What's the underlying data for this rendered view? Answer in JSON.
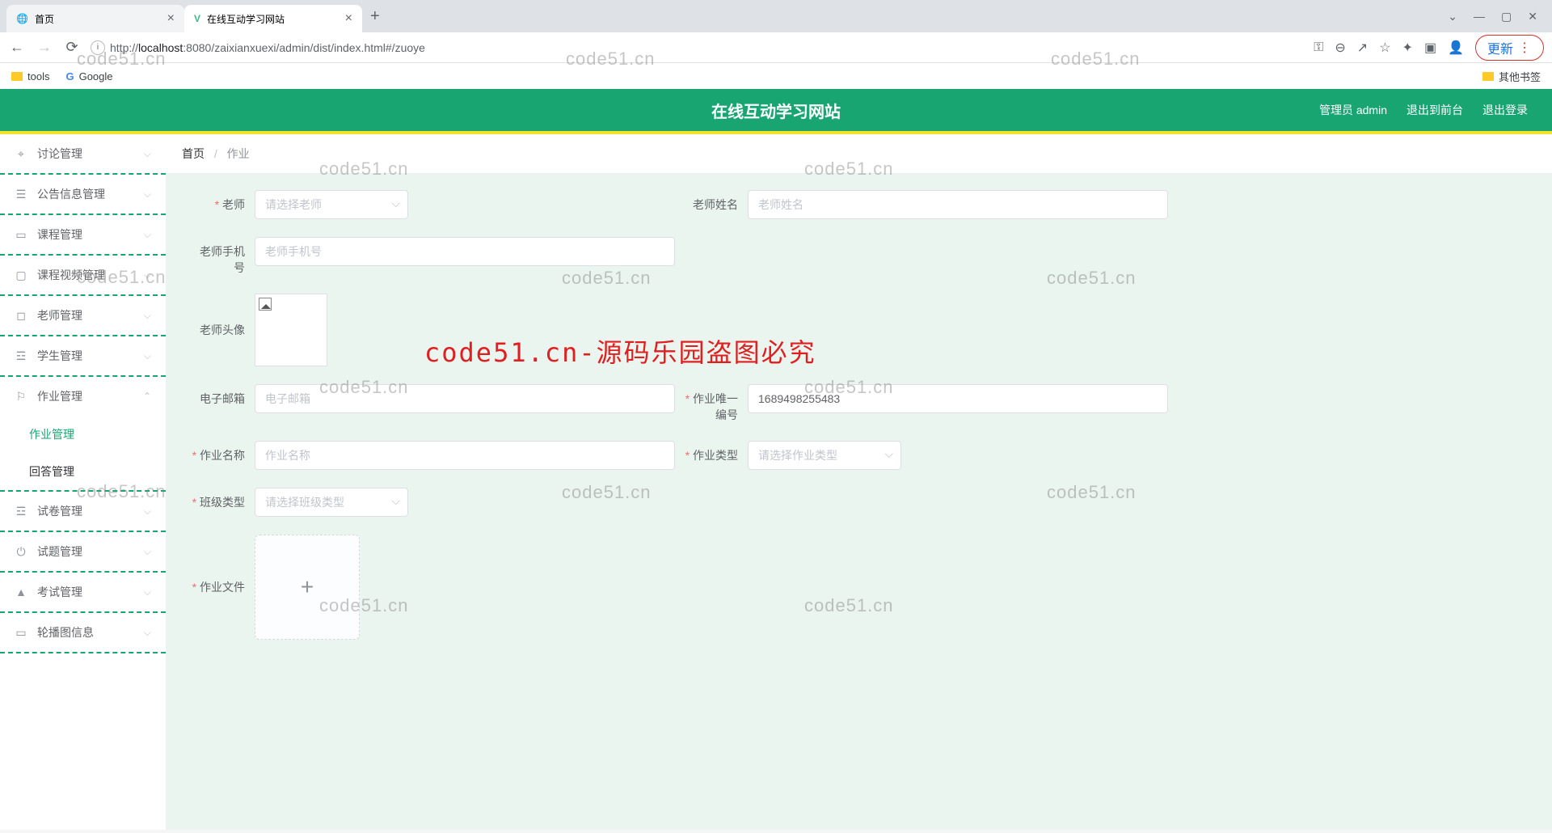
{
  "browser": {
    "tabs": [
      {
        "title": "首页",
        "active": false
      },
      {
        "title": "在线互动学习网站",
        "active": true
      }
    ],
    "url_host": "localhost",
    "url_port": ":8080",
    "url_path": "/zaixianxuexi/admin/dist/index.html#/zuoye",
    "update_label": "更新",
    "bookmarks": {
      "tools": "tools",
      "google": "Google",
      "other": "其他书签"
    }
  },
  "header": {
    "title": "在线互动学习网站",
    "admin": "管理员 admin",
    "front": "退出到前台",
    "logout": "退出登录"
  },
  "sidebar": {
    "items": [
      {
        "label": "讨论管理",
        "expandable": true
      },
      {
        "label": "公告信息管理",
        "expandable": true
      },
      {
        "label": "课程管理",
        "expandable": true
      },
      {
        "label": "课程视频管理",
        "expandable": true
      },
      {
        "label": "老师管理",
        "expandable": true
      },
      {
        "label": "学生管理",
        "expandable": true
      },
      {
        "label": "作业管理",
        "expandable": true,
        "open": true,
        "children": [
          "作业管理",
          "回答管理"
        ]
      },
      {
        "label": "试卷管理",
        "expandable": true
      },
      {
        "label": "试题管理",
        "expandable": true
      },
      {
        "label": "考试管理",
        "expandable": true
      },
      {
        "label": "轮播图信息",
        "expandable": true
      }
    ]
  },
  "breadcrumb": {
    "home": "首页",
    "current": "作业"
  },
  "form": {
    "teacher_label": "老师",
    "teacher_placeholder": "请选择老师",
    "teacher_name_label": "老师姓名",
    "teacher_name_placeholder": "老师姓名",
    "teacher_phone_label": "老师手机号",
    "teacher_phone_placeholder": "老师手机号",
    "teacher_avatar_label": "老师头像",
    "email_label": "电子邮箱",
    "email_placeholder": "电子邮箱",
    "unique_label": "作业唯一编号",
    "unique_value": "1689498255483",
    "name_label": "作业名称",
    "name_placeholder": "作业名称",
    "type_label": "作业类型",
    "type_placeholder": "请选择作业类型",
    "class_label": "班级类型",
    "class_placeholder": "请选择班级类型",
    "file_label": "作业文件",
    "plus": "+"
  },
  "watermark": {
    "text": "code51.cn",
    "red": "code51.cn-源码乐园盗图必究"
  }
}
